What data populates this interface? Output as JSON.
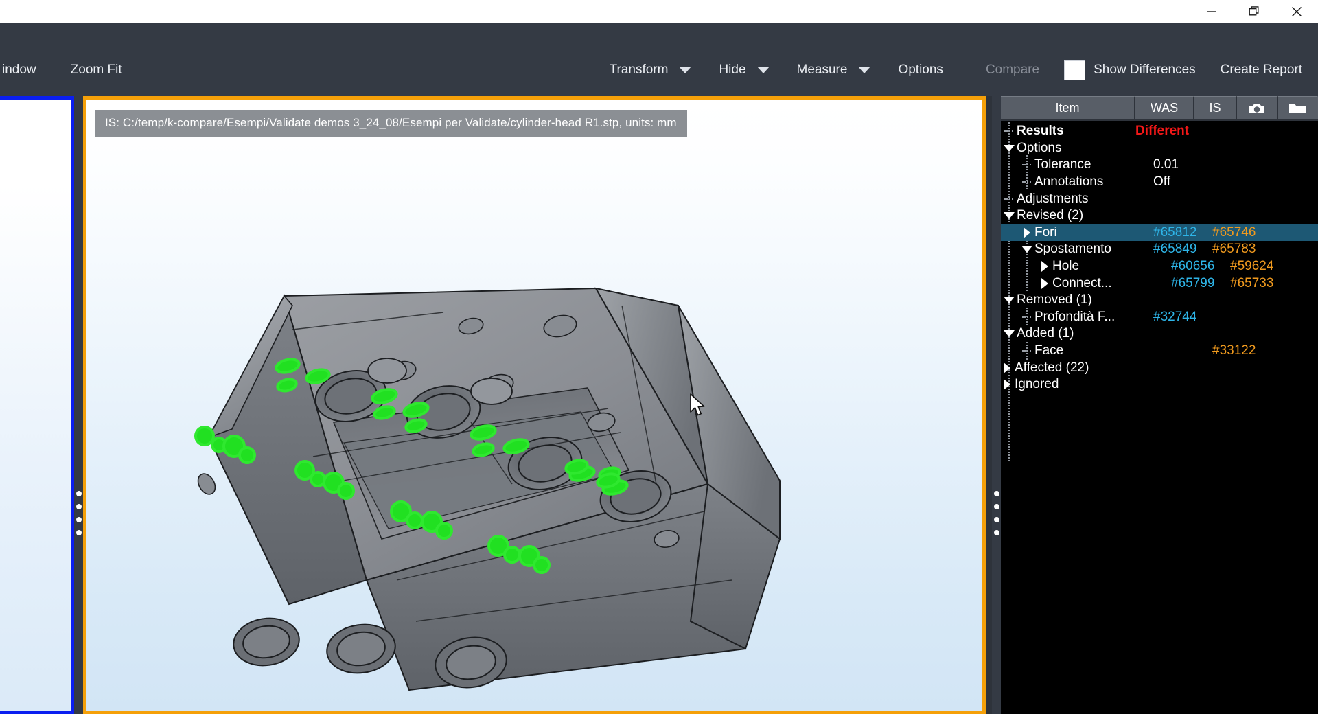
{
  "window": {
    "controls": [
      {
        "name": "minimize",
        "glyph": "minimize-icon"
      },
      {
        "name": "restore",
        "glyph": "restore-icon"
      },
      {
        "name": "close",
        "glyph": "close-icon"
      }
    ]
  },
  "toolbar": {
    "window_label": "indow",
    "zoom_fit_label": "Zoom Fit",
    "transform_label": "Transform",
    "hide_label": "Hide",
    "measure_label": "Measure",
    "options_label": "Options",
    "compare_label": "Compare",
    "compare_disabled": true,
    "show_differences_label": "Show Differences",
    "show_differences_swatch": "#ffffff",
    "create_report_label": "Create Report"
  },
  "viewports": {
    "was": {
      "border_color": "#0a1ef0",
      "label": ""
    },
    "is": {
      "border_color": "#f5a009",
      "label": "IS:  C:/temp/k-compare/Esempi/Validate demos 3_24_08/Esempi per Validate/cylinder-head R1.stp, units: mm"
    }
  },
  "tree": {
    "columns": [
      {
        "key": "item",
        "label": "Item"
      },
      {
        "key": "was",
        "label": "WAS"
      },
      {
        "key": "is",
        "label": "IS"
      },
      {
        "key": "cam",
        "label": "camera-icon"
      },
      {
        "key": "fold",
        "label": "folder-icon"
      }
    ],
    "colors": {
      "was_id": "#2eb5e8",
      "is_id": "#f09a1e",
      "status_different": "#f41818",
      "selected_row": "#1d5874"
    },
    "rows": [
      {
        "label": "Results",
        "indent": 1,
        "twisty": "stub",
        "bold": true,
        "was": "Different",
        "is": "",
        "status": true
      },
      {
        "label": "Options",
        "indent": 1,
        "twisty": "down",
        "bold": false,
        "was": "",
        "is": ""
      },
      {
        "label": "Tolerance",
        "indent": 2,
        "twisty": "stub",
        "bold": false,
        "was": "0.01",
        "is": "",
        "plain": true
      },
      {
        "label": "Annotations",
        "indent": 2,
        "twisty": "stub",
        "bold": false,
        "was": "Off",
        "is": "",
        "plain": true
      },
      {
        "label": "Adjustments",
        "indent": 1,
        "twisty": "stub",
        "bold": false,
        "was": "",
        "is": ""
      },
      {
        "label": "Revised (2)",
        "indent": 1,
        "twisty": "down",
        "bold": false,
        "was": "",
        "is": ""
      },
      {
        "label": "Fori",
        "indent": 2,
        "twisty": "right",
        "bold": false,
        "was": "#65812",
        "is": "#65746",
        "selected": true
      },
      {
        "label": "Spostamento",
        "indent": 2,
        "twisty": "down",
        "bold": false,
        "was": "#65849",
        "is": "#65783"
      },
      {
        "label": "Hole",
        "indent": 3,
        "twisty": "right",
        "bold": false,
        "was": "#60656",
        "is": "#59624"
      },
      {
        "label": "Connect...",
        "indent": 3,
        "twisty": "right",
        "bold": false,
        "was": "#65799",
        "is": "#65733"
      },
      {
        "label": "Removed (1)",
        "indent": 1,
        "twisty": "down",
        "bold": false,
        "was": "",
        "is": ""
      },
      {
        "label": "Profondità F...",
        "indent": 2,
        "twisty": "stub",
        "bold": false,
        "was": "#32744",
        "is": ""
      },
      {
        "label": "Added (1)",
        "indent": 1,
        "twisty": "down",
        "bold": false,
        "was": "",
        "is": ""
      },
      {
        "label": "Face",
        "indent": 2,
        "twisty": "stub",
        "bold": false,
        "was": "",
        "is": "#33122"
      },
      {
        "label": "Affected (22)",
        "indent": 1,
        "twisty": "right",
        "bold": false,
        "was": "",
        "is": ""
      },
      {
        "label": "Ignored",
        "indent": 1,
        "twisty": "right",
        "bold": false,
        "was": "",
        "is": ""
      }
    ]
  },
  "model": {
    "description": "cylinder-head",
    "highlight_color": "#21e021",
    "body_color": "#8d9095"
  }
}
